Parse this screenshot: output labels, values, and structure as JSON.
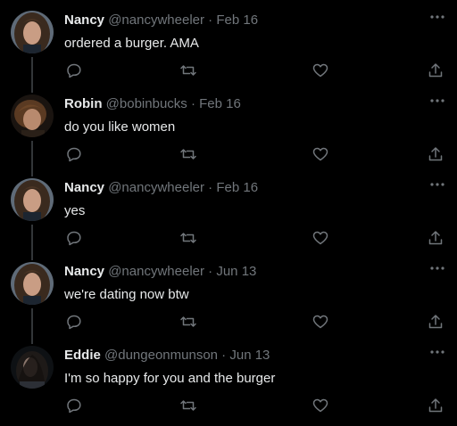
{
  "tweets": [
    {
      "name": "Nancy",
      "handle": "@nancywheeler",
      "date": "Feb 16",
      "text": "ordered a burger. AMA",
      "avatar": "nancy"
    },
    {
      "name": "Robin",
      "handle": "@bobinbucks",
      "date": "Feb 16",
      "text": "do you like women",
      "avatar": "robin"
    },
    {
      "name": "Nancy",
      "handle": "@nancywheeler",
      "date": "Feb 16",
      "text": "yes",
      "avatar": "nancy"
    },
    {
      "name": "Nancy",
      "handle": "@nancywheeler",
      "date": "Jun 13",
      "text": "we're dating now btw",
      "avatar": "nancy"
    },
    {
      "name": "Eddie",
      "handle": "@dungeonmunson",
      "date": "Jun 13",
      "text": "I'm so happy for you and the burger",
      "avatar": "eddie"
    }
  ],
  "separator": " · ",
  "icons": {
    "reply": "reply-icon",
    "retweet": "retweet-icon",
    "like": "heart-icon",
    "share": "share-icon",
    "more": "more-icon"
  },
  "colors": {
    "background": "#000000",
    "text": "#e7e9ea",
    "secondary": "#71767b",
    "thread_line": "#333639"
  }
}
